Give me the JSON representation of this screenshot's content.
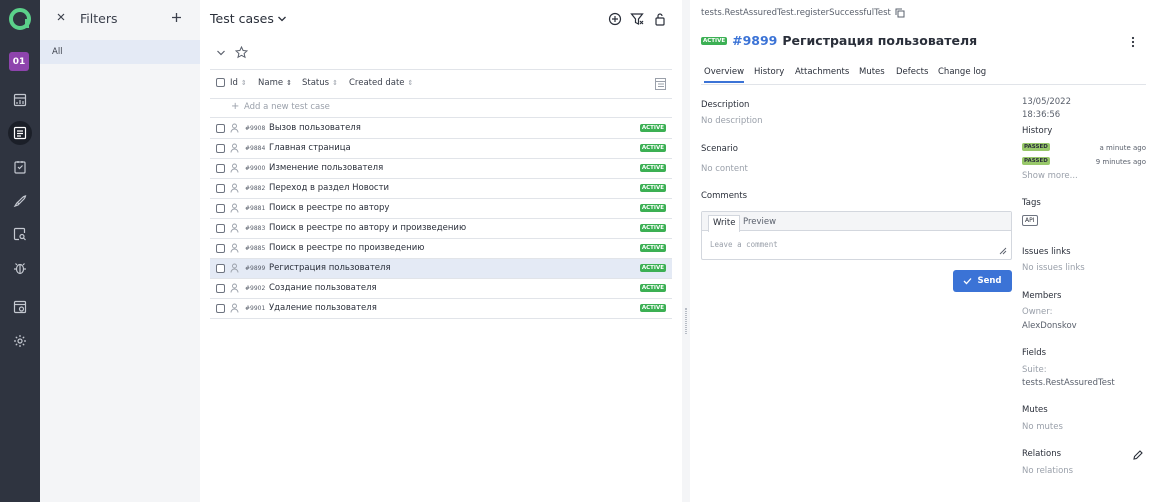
{
  "nav": {
    "project_badge": "01",
    "colors": {
      "bg": "#2f3440",
      "logo": "#5bd08a",
      "project": "#8e44ad"
    }
  },
  "filters": {
    "title": "Filters",
    "items": [
      {
        "label": "All"
      }
    ]
  },
  "list": {
    "title": "Test cases",
    "columns": {
      "id": "Id",
      "name": "Name",
      "status": "Status",
      "created": "Created date"
    },
    "add_placeholder": "Add a new test case",
    "rows": [
      {
        "id": "#9908",
        "name": "Вызов пользователя",
        "status": "ACTIVE",
        "selected": false
      },
      {
        "id": "#9884",
        "name": "Главная страница",
        "status": "ACTIVE",
        "selected": false
      },
      {
        "id": "#9900",
        "name": "Изменение пользователя",
        "status": "ACTIVE",
        "selected": false
      },
      {
        "id": "#9882",
        "name": "Переход в раздел Новости",
        "status": "ACTIVE",
        "selected": false
      },
      {
        "id": "#9881",
        "name": "Поиск в реестре по автору",
        "status": "ACTIVE",
        "selected": false
      },
      {
        "id": "#9883",
        "name": "Поиск в реестре по автору и произведению",
        "status": "ACTIVE",
        "selected": false
      },
      {
        "id": "#9885",
        "name": "Поиск в реестре по произведению",
        "status": "ACTIVE",
        "selected": false
      },
      {
        "id": "#9899",
        "name": "Регистрация пользователя",
        "status": "ACTIVE",
        "selected": true
      },
      {
        "id": "#9902",
        "name": "Создание пользователя",
        "status": "ACTIVE",
        "selected": false
      },
      {
        "id": "#9901",
        "name": "Удаление пользователя",
        "status": "ACTIVE",
        "selected": false
      }
    ]
  },
  "detail": {
    "breadcrumb": "tests.RestAssuredTest.registerSuccessfulTest",
    "status": "ACTIVE",
    "number": "#9899",
    "name": "Регистрация пользователя",
    "tabs": [
      "Overview",
      "History",
      "Attachments",
      "Mutes",
      "Defects",
      "Change log"
    ],
    "description": {
      "label": "Description",
      "value": "No description"
    },
    "scenario": {
      "label": "Scenario",
      "value": "No content"
    },
    "comments": {
      "label": "Comments",
      "write_tab": "Write",
      "preview_tab": "Preview",
      "placeholder": "Leave a comment",
      "send": "Send"
    },
    "side": {
      "date": "13/05/2022",
      "time": "18:36:56",
      "history_label": "History",
      "history": [
        {
          "status": "PASSED",
          "ago": "a minute ago"
        },
        {
          "status": "PASSED",
          "ago": "9 minutes ago"
        }
      ],
      "show_more": "Show more...",
      "tags_label": "Tags",
      "tag": "API",
      "issues_label": "Issues links",
      "issues_value": "No issues links",
      "members_label": "Members",
      "owner_label": "Owner:",
      "owner_value": "AlexDonskov",
      "fields_label": "Fields",
      "suite_label": "Suite:",
      "suite_value": "tests.RestAssuredTest",
      "mutes_label": "Mutes",
      "mutes_value": "No mutes",
      "relations_label": "Relations",
      "relations_value": "No relations"
    }
  }
}
